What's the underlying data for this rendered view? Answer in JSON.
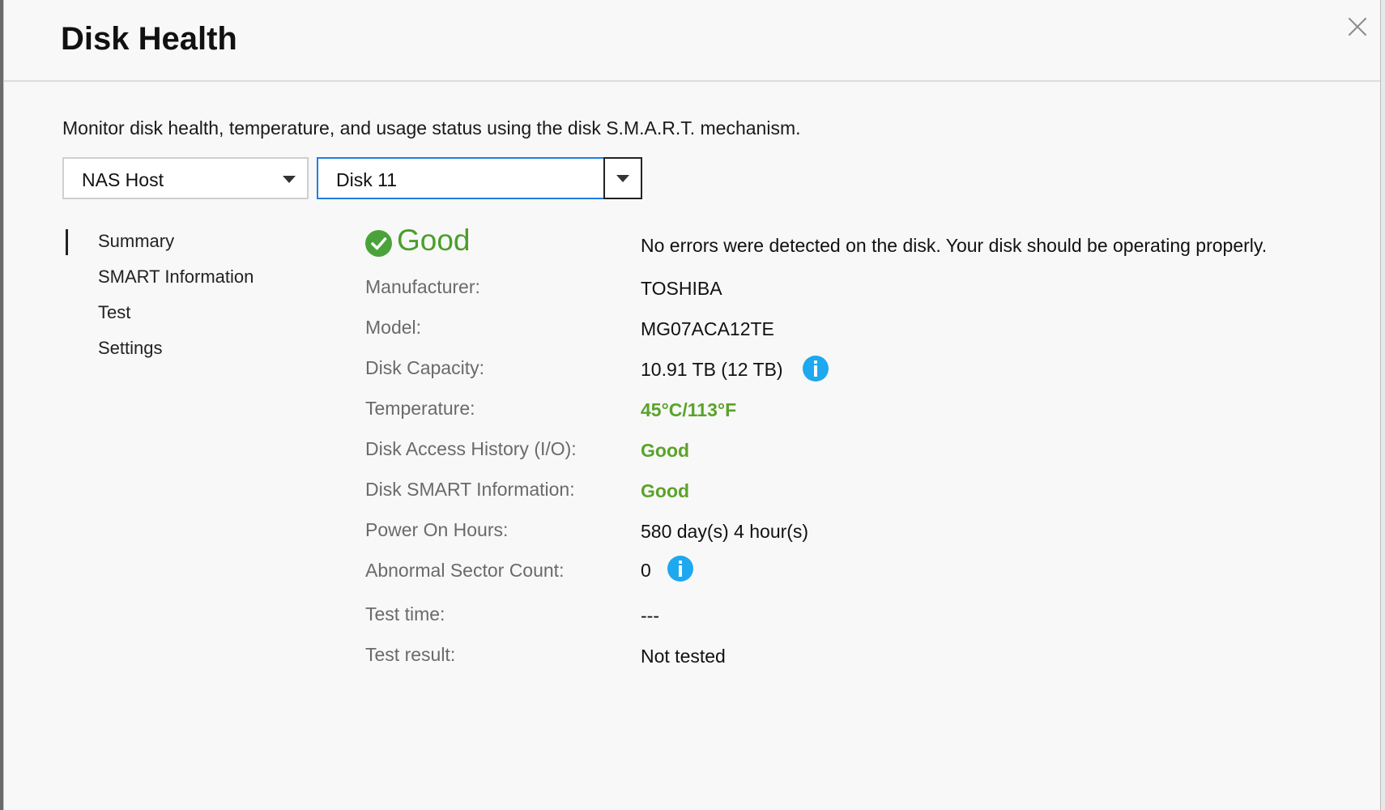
{
  "dialog": {
    "title": "Disk Health",
    "description": "Monitor disk health, temperature, and usage status using the disk S.M.A.R.T. mechanism."
  },
  "selectors": {
    "host": "NAS Host",
    "disk": "Disk 11"
  },
  "nav": {
    "items": [
      "Summary",
      "SMART Information",
      "Test",
      "Settings"
    ],
    "active": "Summary"
  },
  "summary": {
    "status": "Good",
    "message": "No errors were detected on the disk. Your disk should be operating properly.",
    "rows": [
      {
        "label": "Manufacturer:",
        "value": "TOSHIBA"
      },
      {
        "label": "Model:",
        "value": "MG07ACA12TE"
      },
      {
        "label": "Disk Capacity:",
        "value": "10.91 TB (12 TB)"
      },
      {
        "label": "Temperature:",
        "value": "45°C/113°F"
      },
      {
        "label": "Disk Access History (I/O):",
        "value": "Good"
      },
      {
        "label": "Disk SMART Information:",
        "value": "Good"
      },
      {
        "label": "Power On Hours:",
        "value": "580 day(s) 4 hour(s)"
      },
      {
        "label": "Abnormal Sector Count:",
        "value": "0"
      },
      {
        "label": "Test time:",
        "value": "---"
      },
      {
        "label": "Test result:",
        "value": "Not tested"
      }
    ]
  },
  "icons": {
    "status": "check-circle-icon",
    "info": "info-icon",
    "close": "close-icon",
    "dropdown": "chevron-down-icon"
  },
  "colors": {
    "good": "#5aa32a",
    "accent": "#1f7fe3",
    "info": "#1ea8ef"
  }
}
